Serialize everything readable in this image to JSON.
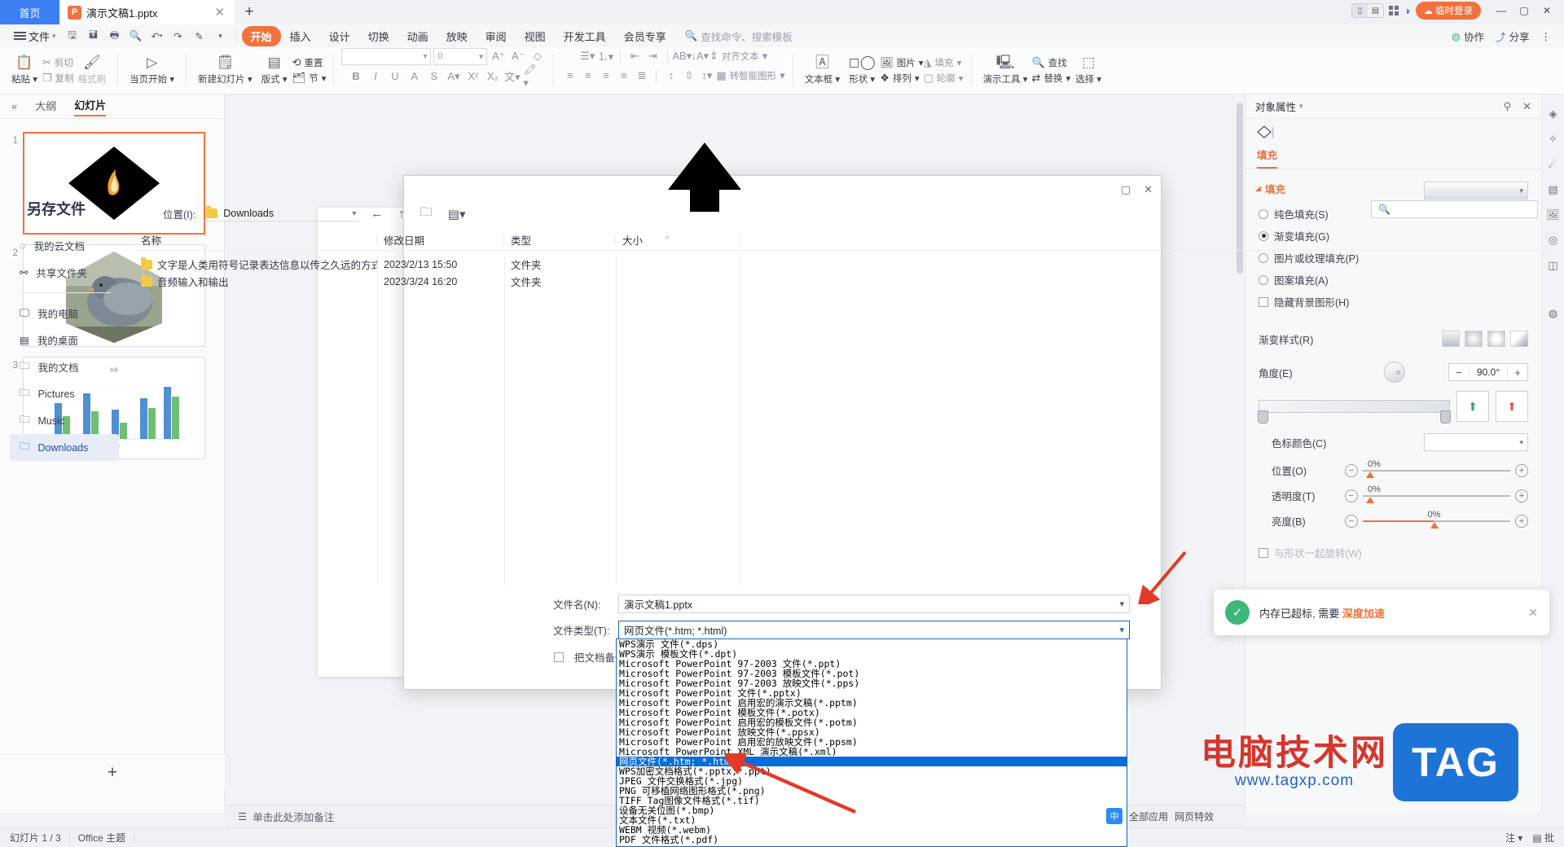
{
  "titlebar": {
    "home_tab": "首页",
    "doc_tab": "演示文稿1.pptx",
    "ppt_badge": "P",
    "close_tab": "✕",
    "new_tab": "+",
    "login_label": "临时登录",
    "minimize": "—",
    "maximize": "▢",
    "close": "✕"
  },
  "menu": {
    "file": "文件",
    "quick_icons": [
      "save-icon",
      "save-as-icon",
      "print-icon",
      "print-preview-icon",
      "undo-icon",
      "redo-icon",
      "format-painter-icon",
      "customize-icon"
    ],
    "tabs": [
      "开始",
      "插入",
      "设计",
      "切换",
      "动画",
      "放映",
      "审阅",
      "视图",
      "开发工具",
      "会员专享"
    ],
    "active_tab": "开始",
    "search_placeholder": "查找命令、搜索模板",
    "right_items": [
      "协作",
      "分享"
    ],
    "more": "⋮"
  },
  "ribbon": {
    "groups": [
      {
        "items": [
          "粘贴",
          "剪切",
          "复制",
          "格式刷"
        ]
      },
      {
        "items": [
          "当页开始"
        ]
      },
      {
        "items": [
          "新建幻灯片",
          "版式",
          "重置",
          "节"
        ]
      }
    ],
    "paste": "粘贴",
    "cut": "剪切",
    "copy": "复制",
    "format_painter": "格式刷",
    "start_page": "当页开始",
    "new_slide": "新建幻灯片",
    "layout": "版式",
    "reset": "重置",
    "section": "节",
    "font_name": "",
    "font_size": "0",
    "bold": "B",
    "italic": "I",
    "underline": "U",
    "align_text": "对齐文本",
    "to_smartart": "转智能图形",
    "textbox": "文本框",
    "shape": "形状",
    "picture": "图片",
    "arrange": "排列",
    "fill": "填充",
    "outline": "轮廓",
    "present_tools": "演示工具",
    "find": "查找",
    "replace": "替换",
    "select": "选择"
  },
  "leftpanel": {
    "outline_tab": "大纲",
    "slide_tab": "幻灯片",
    "collapse": "«",
    "slides": [
      {
        "n": "1",
        "kind": "diamond-flame"
      },
      {
        "n": "2",
        "kind": "pigeon-photo"
      },
      {
        "n": "3",
        "kind": "bar-chart",
        "title": "标题"
      }
    ],
    "add_slide": "+"
  },
  "notes": {
    "placeholder": "单击此处添加备注",
    "icon": "notes-icon"
  },
  "rightpanel": {
    "title": "对象属性",
    "pin": "pin-icon",
    "close": "✕",
    "tab": "填充",
    "section": "填充",
    "fill_options": [
      {
        "label": "纯色填充(S)",
        "selected": false
      },
      {
        "label": "渐变填充(G)",
        "selected": true
      },
      {
        "label": "图片或纹理填充(P)",
        "selected": false
      },
      {
        "label": "图案填充(A)",
        "selected": false
      }
    ],
    "hide_bg_label": "隐藏背景图形(H)",
    "gradient_style_label": "渐变样式(R)",
    "angle_label": "角度(E)",
    "angle_value": "90.0°",
    "minus": "−",
    "plus": "+",
    "stop_color_label": "色标颜色(C)",
    "position_label": "位置(O)",
    "position_value": "0%",
    "transparency_label": "透明度(T)",
    "transparency_value": "0%",
    "brightness_label": "亮度(B)",
    "brightness_value": "0%",
    "rotate_with_shape": "与形状一起旋转(W)",
    "accent": "#f2713c"
  },
  "statusbar": {
    "slide_count": "幻灯片 1 / 3",
    "theme": "Office 主题",
    "right_items": [
      "注",
      "批"
    ]
  },
  "dialog": {
    "title": "另存文件",
    "location_label": "位置(I):",
    "location_value": "Downloads",
    "nav": [
      "back-arrow-icon",
      "up-arrow-icon",
      "new-folder-icon",
      "view-mode-icon"
    ],
    "search_placeholder": "",
    "maximize": "▢",
    "close": "✕",
    "sidebar": [
      "我的云文档",
      "共享文件夹",
      "我的电脑",
      "我的桌面",
      "我的文档",
      "Pictures",
      "Music",
      "Downloads"
    ],
    "sidebar_selected": "Downloads",
    "columns": [
      "名称",
      "修改日期",
      "类型",
      "大小"
    ],
    "rows": [
      {
        "name": "文字是人类用符号记录表达信息以传之久远的方式...",
        "date": "2023/2/13 15:50",
        "type": "文件夹",
        "size": ""
      },
      {
        "name": "音频输入和输出",
        "date": "2023/3/24 16:20",
        "type": "文件夹",
        "size": ""
      }
    ],
    "filename_label": "文件名(N):",
    "filename_value": "演示文稿1.pptx",
    "filetype_label": "文件类型(T):",
    "filetype_value": "网页文件(*.htm; *.html)",
    "backup_checkbox": "把文档备份",
    "filetype_options": [
      "WPS演示 文件(*.dps)",
      "WPS演示 模板文件(*.dpt)",
      "Microsoft PowerPoint 97-2003 文件(*.ppt)",
      "Microsoft PowerPoint 97-2003 模板文件(*.pot)",
      "Microsoft PowerPoint 97-2003 放映文件(*.pps)",
      "Microsoft PowerPoint 文件(*.pptx)",
      "Microsoft PowerPoint 启用宏的演示文稿(*.pptm)",
      "Microsoft PowerPoint 模板文件(*.potx)",
      "Microsoft PowerPoint 启用宏的模板文件(*.potm)",
      "Microsoft PowerPoint 放映文件(*.ppsx)",
      "Microsoft PowerPoint 启用宏的放映文件(*.ppsm)",
      "Microsoft PowerPoint XML 演示文稿(*.xml)",
      "网页文件(*.htm; *.html)",
      "WPS加密文档格式(*.pptx;*.ppt)",
      "JPEG 文件交换格式(*.jpg)",
      "PNG 可移植网络图形格式(*.png)",
      "TIFF Tag图像文件格式(*.tif)",
      "设备无关位图(*.bmp)",
      "文本文件(*.txt)",
      "WEBM 视频(*.webm)",
      "PDF 文件格式(*.pdf)"
    ],
    "filetype_selected_index": 12
  },
  "notification": {
    "text_pre": "内存已超标, 需要",
    "text_em": "深度加速",
    "close": "✕",
    "icon": "shield-icon"
  },
  "watermark": {
    "cn": "电脑技术网",
    "url": "www.tagxp.com",
    "tag": "TAG"
  },
  "tray": {
    "ime": "中",
    "items": [
      "全部应用",
      "网页特效"
    ]
  }
}
